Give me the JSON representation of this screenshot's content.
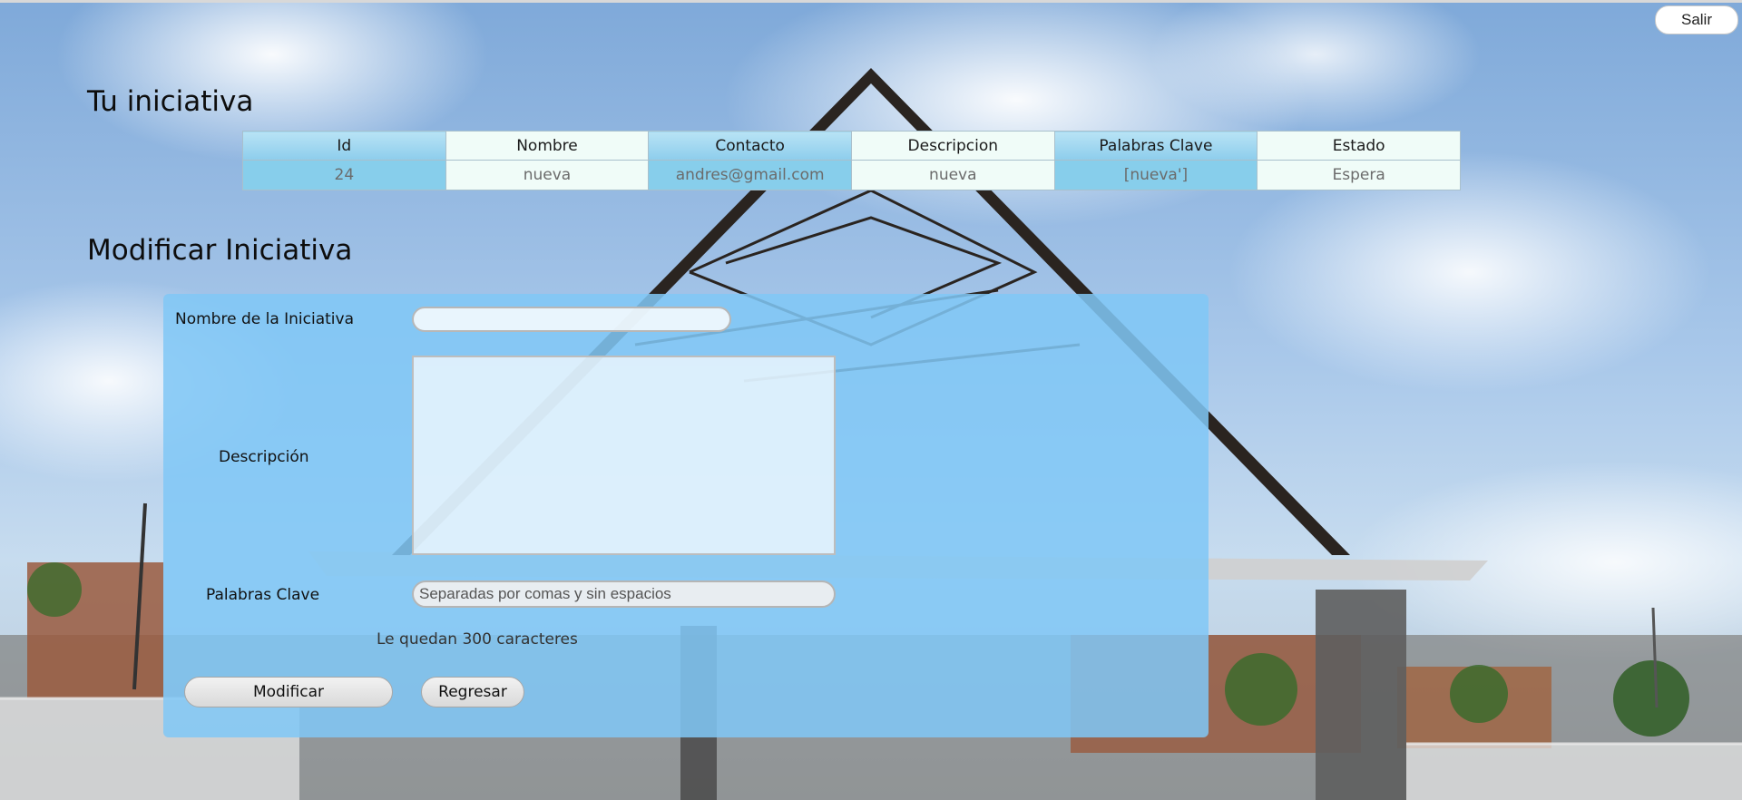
{
  "header": {
    "exit_label": "Salir"
  },
  "initiative": {
    "title": "Tu iniciativa",
    "columns": [
      "Id",
      "Nombre",
      "Contacto",
      "Descripcion",
      "Palabras Clave",
      "Estado"
    ],
    "rows": [
      [
        "24",
        "nueva",
        "andres@gmail.com",
        "nueva",
        "[nueva']",
        "Espera"
      ]
    ]
  },
  "form": {
    "title": "Modificar Iniciativa",
    "name_label": "Nombre de la Iniciativa",
    "name_value": "",
    "description_label": "Descripción",
    "description_value": "",
    "keywords_label": "Palabras Clave",
    "keywords_placeholder": "Separadas por comas y sin espacios",
    "counter_text": "Le quedan 300 caracteres",
    "submit_label": "Modificar",
    "back_label": "Regresar"
  },
  "colors": {
    "panel": "#80c7f6",
    "table_blue": "#87ceeb",
    "table_white": "#f0fcf8"
  }
}
